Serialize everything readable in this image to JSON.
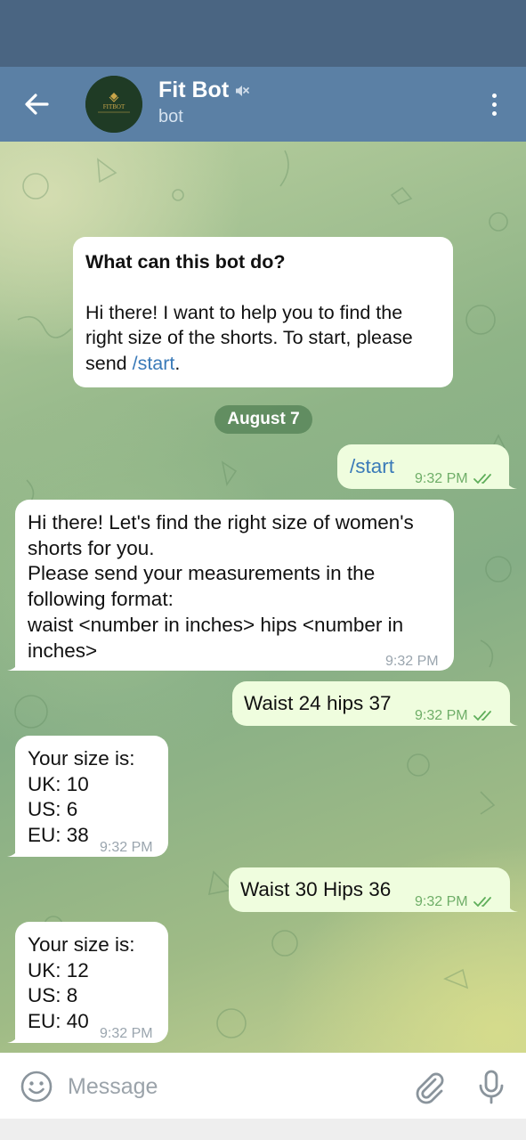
{
  "header": {
    "title": "Fit Bot",
    "subtitle": "bot",
    "avatar_text": "FITBOT"
  },
  "info_card": {
    "title": "What can this bot do?",
    "text_before": "Hi there! I want to help you to find the right size of the shorts. To start, please send ",
    "link": "/start",
    "text_after": "."
  },
  "date_separator": "August 7",
  "messages": [
    {
      "direction": "out",
      "text": "/start",
      "time": "9:32 PM",
      "is_command": true
    },
    {
      "direction": "in",
      "text": "Hi there! Let's find the right size of women's shorts for you.\nPlease send your measurements in the following format:\nwaist <number in inches> hips <number in inches>",
      "time": "9:32 PM"
    },
    {
      "direction": "out",
      "text": "Waist 24 hips 37",
      "time": "9:32 PM"
    },
    {
      "direction": "in",
      "text": "Your size is:\nUK: 10\nUS: 6\nEU: 38",
      "time": "9:32 PM"
    },
    {
      "direction": "out",
      "text": "Waist 30 Hips 36",
      "time": "9:32 PM"
    },
    {
      "direction": "in",
      "text": "Your size is:\nUK: 12\nUS: 8\nEU: 40",
      "time": "9:32 PM"
    }
  ],
  "composer": {
    "placeholder": "Message"
  },
  "icons": {
    "back": "arrow-left-icon",
    "mute": "muted-speaker-icon",
    "menu": "more-vertical-icon",
    "emoji": "smiley-icon",
    "attach": "paperclip-icon",
    "mic": "microphone-icon",
    "read": "double-check-icon"
  },
  "colors": {
    "header": "#5b80a5",
    "status_bar": "#4a6582",
    "outgoing_bubble": "#effdde",
    "incoming_bubble": "#ffffff",
    "link": "#3a7ab8",
    "read_ticks": "#5fae5a"
  }
}
